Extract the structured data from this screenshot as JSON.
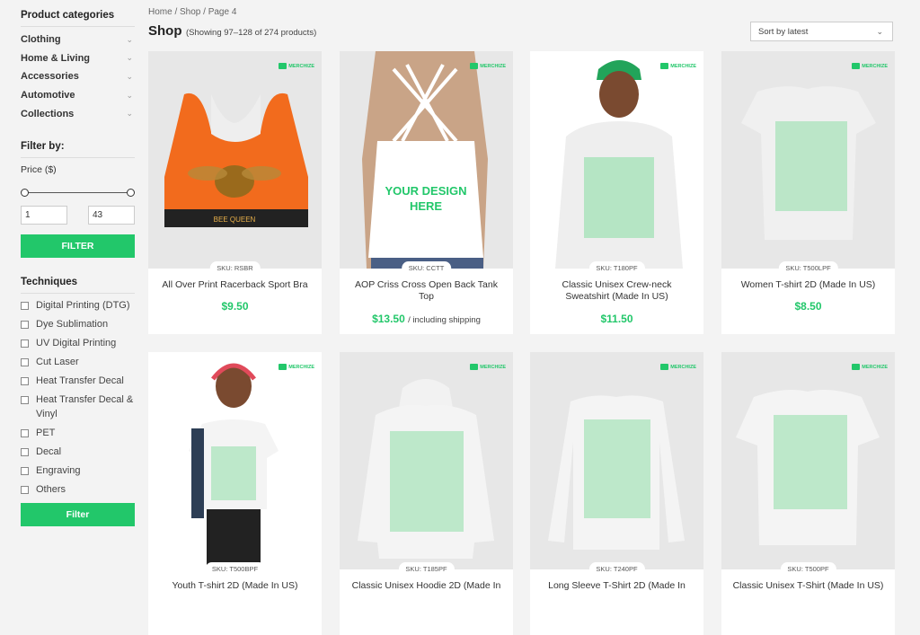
{
  "sidebar": {
    "categories_title": "Product categories",
    "categories": [
      "Clothing",
      "Home & Living",
      "Accessories",
      "Automotive",
      "Collections"
    ],
    "filter_title": "Filter by:",
    "price_label": "Price ($)",
    "price_min": "1",
    "price_max": "43",
    "filter_button": "FILTER",
    "techniques_title": "Techniques",
    "techniques": [
      "Digital Printing (DTG)",
      "Dye Sublimation",
      "UV Digital Printing",
      "Cut Laser",
      "Heat Transfer Decal",
      "Heat Transfer Decal & Vinyl",
      "PET",
      "Decal",
      "Engraving",
      "Others"
    ],
    "techniques_button": "Filter"
  },
  "header": {
    "breadcrumb": "Home / Shop / Page 4",
    "title": "Shop",
    "showing": "(Showing 97–128 of 274 products)",
    "sort": "Sort by latest"
  },
  "brand": {
    "logo_text": "MERCHIZE",
    "accent": "#22c76a"
  },
  "products": [
    {
      "sku": "SKU: RSBR",
      "name": "All Over Print Racerback Sport Bra",
      "price": "$9.50",
      "note": ""
    },
    {
      "sku": "SKU: CCTT",
      "name": "AOP Criss Cross Open Back Tank Top",
      "price": "$13.50",
      "note": "/ including shipping"
    },
    {
      "sku": "SKU: T180PF",
      "name": "Classic Unisex Crew-neck Sweatshirt (Made In US)",
      "price": "$11.50",
      "note": ""
    },
    {
      "sku": "SKU: T500LPF",
      "name": "Women T-shirt 2D (Made In US)",
      "price": "$8.50",
      "note": ""
    },
    {
      "sku": "SKU: T500BPF",
      "name": "Youth T-shirt 2D (Made In US)",
      "price": "",
      "note": ""
    },
    {
      "sku": "SKU: T185PF",
      "name": "Classic Unisex Hoodie 2D (Made In",
      "price": "",
      "note": ""
    },
    {
      "sku": "SKU: T240PF",
      "name": "Long Sleeve T-Shirt 2D (Made In",
      "price": "",
      "note": ""
    },
    {
      "sku": "SKU: T500PF",
      "name": "Classic Unisex T-Shirt (Made In US)",
      "price": "",
      "note": ""
    }
  ]
}
